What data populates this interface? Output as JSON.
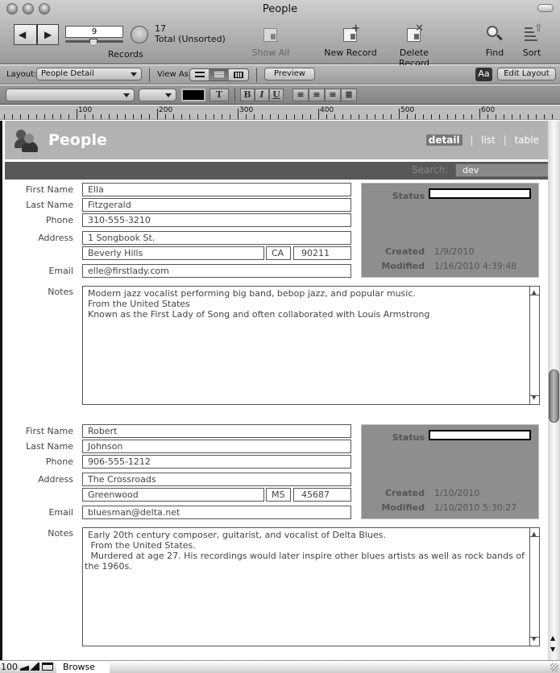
{
  "window": {
    "title": "People"
  },
  "toolbar": {
    "record_number": "9",
    "total_count": "17",
    "total_label": "Total (Unsorted)",
    "records_label": "Records",
    "show_all_label": "Show All",
    "new_record_label": "New Record",
    "delete_record_label": "Delete Record",
    "find_label": "Find",
    "sort_label": "Sort"
  },
  "layout_bar": {
    "layout_label": "Layout:",
    "layout_value": "People Detail",
    "view_as_label": "View As:",
    "view_as_options": [
      "form",
      "list",
      "table"
    ],
    "view_as_selected": "list",
    "preview_label": "Preview",
    "aa_label": "Aa",
    "edit_layout_label": "Edit Layout"
  },
  "format_bar": {
    "font_value": "",
    "size_value": "",
    "text_color": "#000000",
    "t_label": "T",
    "bold_label": "B",
    "italic_label": "I",
    "underline_label": "U"
  },
  "ruler": {
    "labels": [
      "100",
      "200",
      "300",
      "400",
      "500",
      "600"
    ]
  },
  "header": {
    "title": "People",
    "tabs": [
      {
        "label": "detail",
        "active": true
      },
      {
        "label": "list",
        "active": false
      },
      {
        "label": "table",
        "active": false
      }
    ],
    "separator": "|",
    "search_label": "Search:",
    "search_value": "dev"
  },
  "labels": {
    "first_name": "First Name",
    "last_name": "Last Name",
    "phone": "Phone",
    "address": "Address",
    "email": "Email",
    "notes": "Notes",
    "status": "Status",
    "created": "Created",
    "modified": "Modified"
  },
  "records": [
    {
      "first_name": "Ella",
      "last_name": "Fitzgerald",
      "phone": "310-555-3210",
      "address1": "1 Songbook St.",
      "city": "Beverly Hills",
      "state": "CA",
      "zip": "90211",
      "email": "elle@firstlady.com",
      "status": "",
      "created": "1/9/2010",
      "modified": "1/16/2010 4:39:48",
      "notes": [
        "Modern jazz vocalist performing big band, bebop jazz, and popular music.",
        "From the United States",
        "Known as the First Lady of Song and often collaborated with Louis Armstrong"
      ]
    },
    {
      "first_name": "Robert",
      "last_name": "Johnson",
      "phone": "906-555-1212",
      "address1": "The Crossroads",
      "city": "Greenwood",
      "state": "MS",
      "zip": "45687",
      "email": "bluesman@delta.net",
      "status": "",
      "created": "1/10/2010",
      "modified": "1/10/2010 5:30:27",
      "notes": [
        "Early 20th century composer, guitarist, and vocalist of Delta Blues.",
        " From the United States.",
        " Murdered at age 27. His recordings would later inspire other blues artists as well as rock bands of",
        "the 1960s."
      ]
    }
  ],
  "statusbar": {
    "zoom": "100",
    "mode": "Browse"
  }
}
